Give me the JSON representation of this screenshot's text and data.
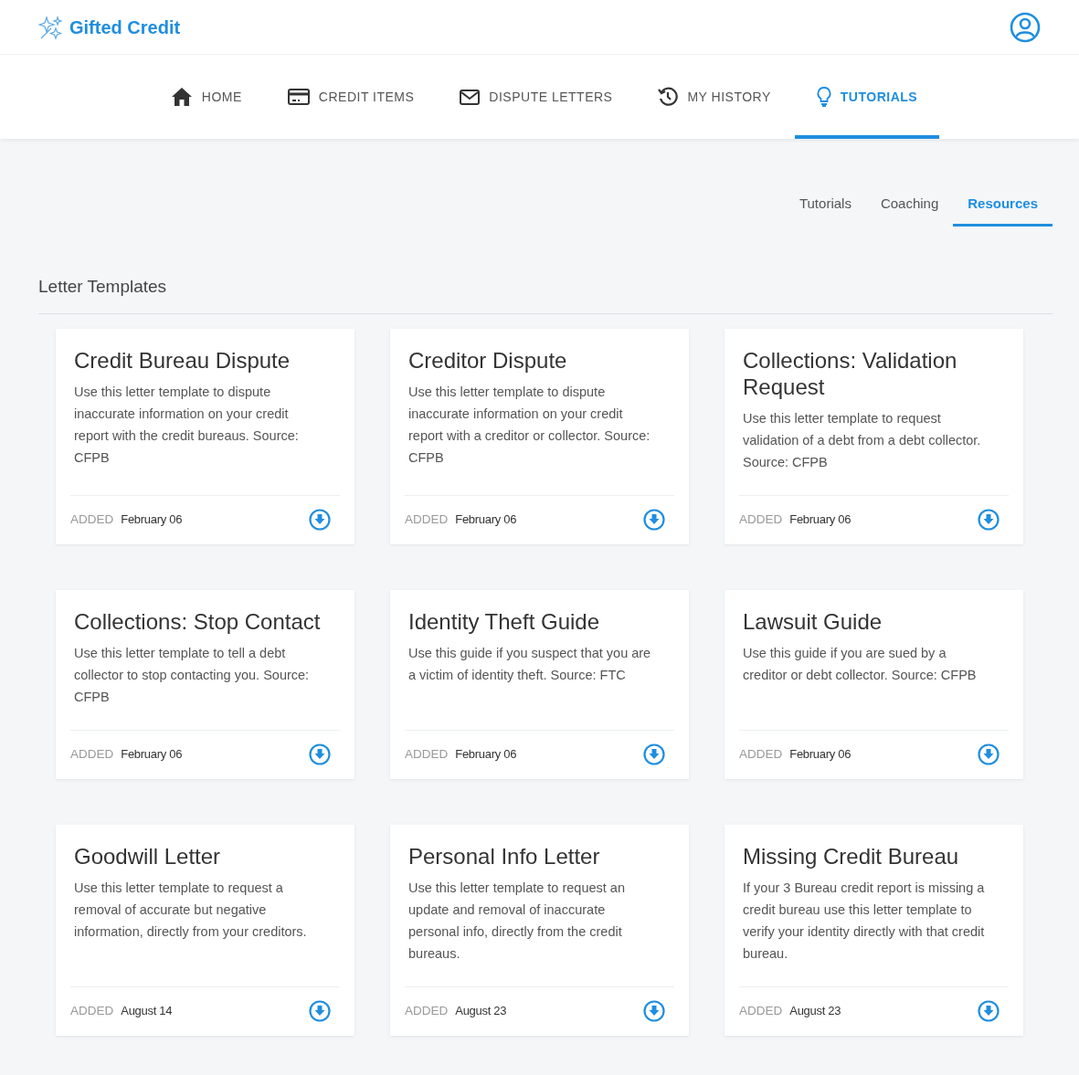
{
  "brand": "Gifted Credit",
  "nav": [
    {
      "label": "HOME",
      "selected": false
    },
    {
      "label": "CREDIT ITEMS",
      "selected": false
    },
    {
      "label": "DISPUTE LETTERS",
      "selected": false
    },
    {
      "label": "MY HISTORY",
      "selected": false
    },
    {
      "label": "TUTORIALS",
      "selected": true
    }
  ],
  "subtabs": [
    {
      "label": "Tutorials",
      "selected": false
    },
    {
      "label": "Coaching",
      "selected": false
    },
    {
      "label": "Resources",
      "selected": true
    }
  ],
  "section_title": "Letter Templates",
  "cards": [
    {
      "title": "Credit Bureau Dispute",
      "description": "Use this letter template to dispute inaccurate information on your credit report with the credit bureaus. Source: CFPB",
      "added_label": "ADDED",
      "date": "February 06"
    },
    {
      "title": "Creditor Dispute",
      "description": "Use this letter template to dispute inaccurate information on your credit report with a creditor or collector. Source: CFPB",
      "added_label": "ADDED",
      "date": "February 06"
    },
    {
      "title": "Collections: Validation Request",
      "description": "Use this letter template to request validation of a debt from a debt collector. Source: CFPB",
      "added_label": "ADDED",
      "date": "February 06"
    },
    {
      "title": "Collections: Stop Contact",
      "description": "Use this letter template to tell a debt collector to stop contacting you. Source: CFPB",
      "added_label": "ADDED",
      "date": "February 06"
    },
    {
      "title": "Identity Theft Guide",
      "description": "Use this guide if you suspect that you are a victim of identity theft. Source: FTC",
      "added_label": "ADDED",
      "date": "February 06"
    },
    {
      "title": "Lawsuit Guide",
      "description": "Use this guide if you are sued by a creditor or debt collector. Source: CFPB",
      "added_label": "ADDED",
      "date": "February 06"
    },
    {
      "title": "Goodwill Letter",
      "description": "Use this letter template to request a removal of accurate but negative information, directly from your creditors.",
      "added_label": "ADDED",
      "date": "August 14"
    },
    {
      "title": "Personal Info Letter",
      "description": "Use this letter template to request an update and removal of inaccurate personal info, directly from the credit bureaus.",
      "added_label": "ADDED",
      "date": "August 23"
    },
    {
      "title": "Missing Credit Bureau",
      "description": "If your 3 Bureau credit report is missing a credit bureau use this letter template to verify your identity directly with that credit bureau.",
      "added_label": "ADDED",
      "date": "August 23"
    }
  ]
}
